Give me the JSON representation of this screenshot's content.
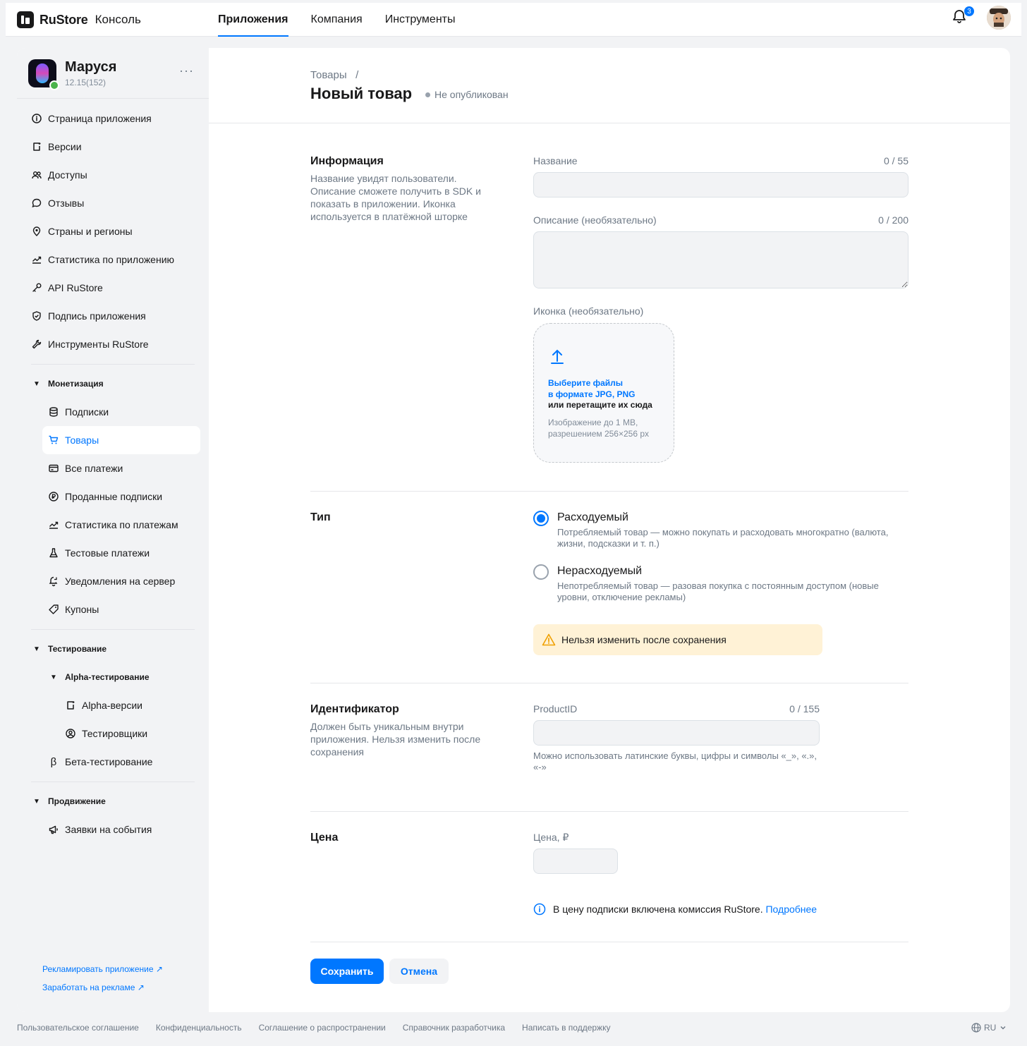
{
  "brand": {
    "name": "RuStore",
    "product": "Консоль"
  },
  "topnav": [
    {
      "label": "Приложения",
      "active": true
    },
    {
      "label": "Компания",
      "active": false
    },
    {
      "label": "Инструменты",
      "active": false
    }
  ],
  "notifications": {
    "count": "3",
    "icon": "bell-icon"
  },
  "colors": {
    "accent": "#0077ff",
    "warning_bg": "#fff2d6",
    "online": "#4bb34b"
  },
  "app": {
    "name": "Маруся",
    "version": "12.15(152)",
    "more": "···"
  },
  "sidebar": {
    "items": [
      {
        "label": "Страница приложения",
        "icon": "info-icon"
      },
      {
        "label": "Версии",
        "icon": "versions-icon"
      },
      {
        "label": "Доступы",
        "icon": "users-icon"
      },
      {
        "label": "Отзывы",
        "icon": "comment-icon"
      },
      {
        "label": "Страны и регионы",
        "icon": "location-icon"
      },
      {
        "label": "Статистика по приложению",
        "icon": "stats-icon"
      },
      {
        "label": "API RuStore",
        "icon": "key-icon"
      },
      {
        "label": "Подпись приложения",
        "icon": "shield-icon"
      },
      {
        "label": "Инструменты RuStore",
        "icon": "wrench-icon"
      }
    ],
    "monetization": {
      "label": "Монетизация",
      "items": [
        {
          "label": "Подписки",
          "icon": "database-icon"
        },
        {
          "label": "Товары",
          "icon": "cart-icon",
          "active": true
        },
        {
          "label": "Все платежи",
          "icon": "card-icon"
        },
        {
          "label": "Проданные подписки",
          "icon": "ruble-icon"
        },
        {
          "label": "Статистика по платежам",
          "icon": "stats-icon"
        },
        {
          "label": "Тестовые платежи",
          "icon": "flask-icon"
        },
        {
          "label": "Уведомления на сервер",
          "icon": "bell-sync-icon"
        },
        {
          "label": "Купоны",
          "icon": "coupon-icon"
        }
      ]
    },
    "testing": {
      "label": "Тестирование",
      "alpha": {
        "label": "Alpha-тестирование",
        "items": [
          {
            "label": "Alpha-версии",
            "icon": "versions-icon"
          },
          {
            "label": "Тестировщики",
            "icon": "user-circle-icon"
          }
        ]
      },
      "beta": {
        "label": "Бета-тестирование",
        "icon": "beta-icon"
      }
    },
    "promotion": {
      "label": "Продвижение",
      "items": [
        {
          "label": "Заявки на события",
          "icon": "megaphone-icon"
        }
      ]
    },
    "links": [
      {
        "label": "Рекламировать приложение ↗"
      },
      {
        "label": "Заработать на рекламе ↗"
      }
    ]
  },
  "page": {
    "breadcrumb": "Товары   /",
    "title": "Новый товар",
    "status": "Не опубликован"
  },
  "info_block": {
    "title": "Информация",
    "desc": "Название увидят пользователи. Описание сможете получить в SDK и показать в приложении. Иконка используется в платёжной шторке",
    "name_label": "Название",
    "name_counter": "0 / 55",
    "name_value": "",
    "desc_label": "Описание (необязательно)",
    "desc_counter": "0 / 200",
    "desc_value": "",
    "icon_label": "Иконка (необязательно)",
    "dz_link_1": "Выберите файлы",
    "dz_link_2": "в формате JPG, PNG",
    "dz_or": "или перетащите их сюда",
    "dz_note": "Изображение до 1 MB, разрешением 256×256 px"
  },
  "type_block": {
    "title": "Тип",
    "options": [
      {
        "label": "Расходуемый",
        "desc": "Потребляемый товар — можно покупать и расходовать многократно (валюта, жизни, подсказки и т. п.)",
        "selected": true
      },
      {
        "label": "Нерасходуемый",
        "desc": "Непотребляемый товар — разовая покупка с постоянным доступом (новые уровни, отключение рекламы)",
        "selected": false
      }
    ],
    "warning": "Нельзя изменить после сохранения"
  },
  "id_block": {
    "title": "Идентификатор",
    "desc": "Должен быть уникальным внутри приложения. Нельзя изменить после сохранения",
    "field_label": "ProductID",
    "counter": "0 / 155",
    "value": "",
    "hint": "Можно использовать латинские буквы, цифры и символы «_», «.», «-»"
  },
  "price_block": {
    "title": "Цена",
    "field_label": "Цена, ₽",
    "value": "",
    "info": "В цену подписки включена комиссия RuStore.",
    "info_link": "Подробнее"
  },
  "actions": {
    "save": "Сохранить",
    "cancel": "Отмена"
  },
  "footer": {
    "links": [
      "Пользовательское соглашение",
      "Конфиденциальность",
      "Соглашение о распространении",
      "Справочник разработчика",
      "Написать в поддержку"
    ],
    "lang": "RU"
  }
}
